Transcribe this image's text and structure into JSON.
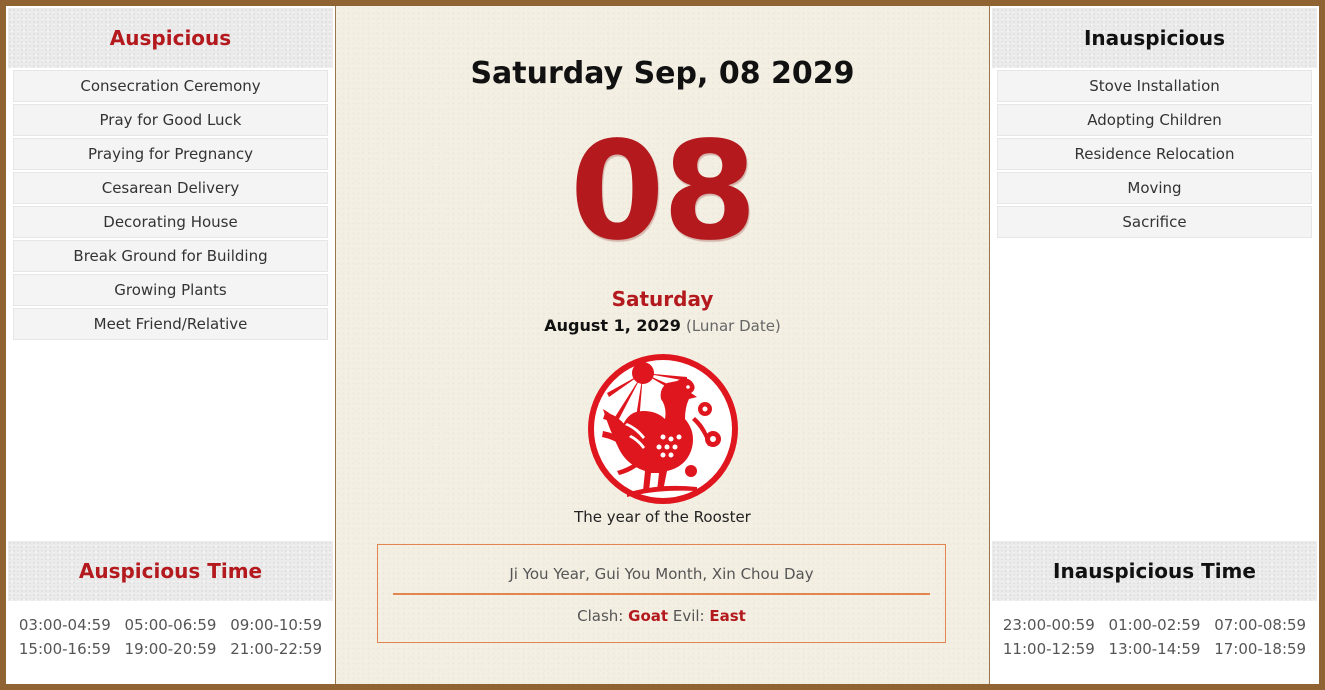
{
  "auspicious": {
    "title": "Auspicious",
    "items": [
      "Consecration Ceremony",
      "Pray for Good Luck",
      "Praying for Pregnancy",
      "Cesarean Delivery",
      "Decorating House",
      "Break Ground for Building",
      "Growing Plants",
      "Meet Friend/Relative"
    ]
  },
  "auspicious_time": {
    "title": "Auspicious Time",
    "slots": [
      "03:00-04:59",
      "05:00-06:59",
      "09:00-10:59",
      "15:00-16:59",
      "19:00-20:59",
      "21:00-22:59"
    ]
  },
  "inauspicious": {
    "title": "Inauspicious",
    "items": [
      "Stove Installation",
      "Adopting Children",
      "Residence Relocation",
      "Moving",
      "Sacrifice"
    ]
  },
  "inauspicious_time": {
    "title": "Inauspicious Time",
    "slots": [
      "23:00-00:59",
      "01:00-02:59",
      "07:00-08:59",
      "11:00-12:59",
      "13:00-14:59",
      "17:00-18:59"
    ]
  },
  "center": {
    "full_date": "Saturday Sep, 08 2029",
    "day_number": "08",
    "weekday": "Saturday",
    "lunar_date": "August 1, 2029",
    "lunar_note": "(Lunar Date)",
    "zodiac_icon": "rooster-papercut-icon",
    "zodiac_caption": "The year of the Rooster",
    "ganzhi": "Ji You Year, Gui You Month, Xin Chou Day",
    "clash_label": "Clash:",
    "clash_value": "Goat",
    "evil_label": "Evil:",
    "evil_value": "East"
  },
  "colors": {
    "accent_red": "#b3191d",
    "frame_brown": "#8f6332",
    "box_orange": "#e3854e"
  }
}
